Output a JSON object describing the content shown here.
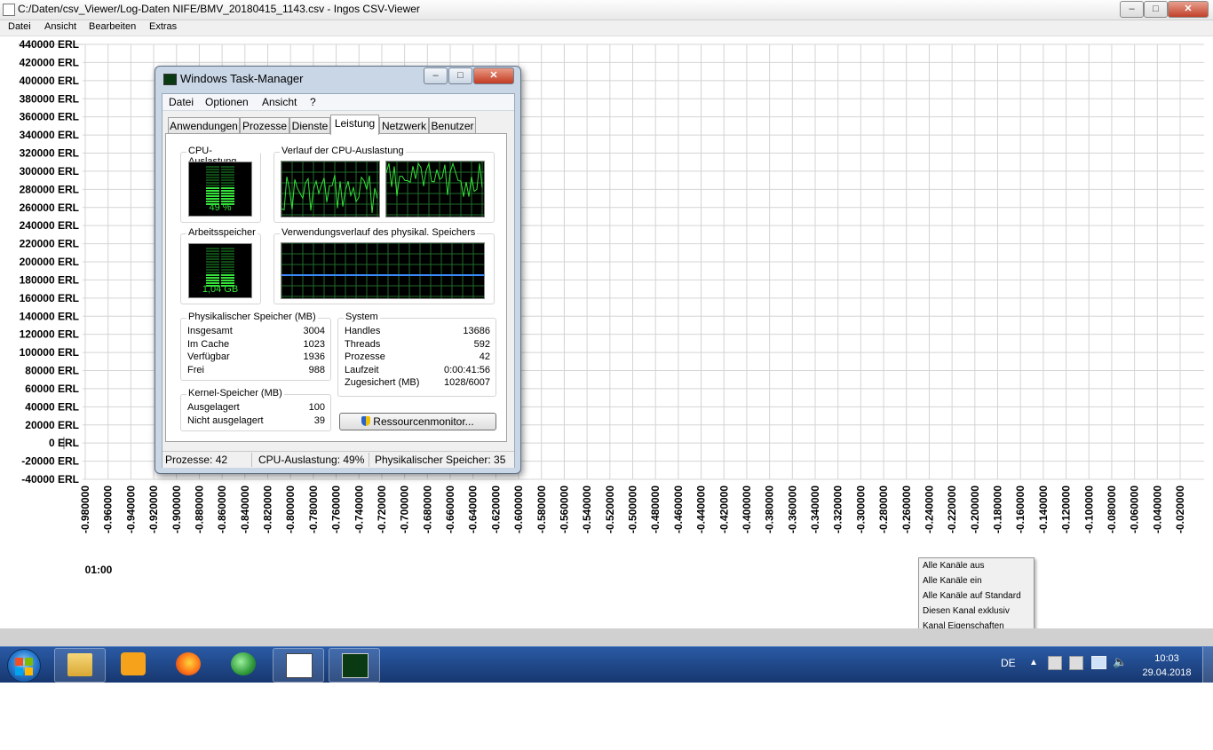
{
  "window": {
    "title": "C:/Daten/csv_Viewer/Log-Daten NIFE/BMV_20180415_1143.csv - Ingos CSV-Viewer",
    "menu": [
      "Datei",
      "Ansicht",
      "Bearbeiten",
      "Extras"
    ]
  },
  "chart": {
    "y_ticks": [
      "440000 ERL",
      "420000 ERL",
      "400000 ERL",
      "380000 ERL",
      "360000 ERL",
      "340000 ERL",
      "320000 ERL",
      "300000 ERL",
      "280000 ERL",
      "260000 ERL",
      "240000 ERL",
      "220000 ERL",
      "200000 ERL",
      "180000 ERL",
      "160000 ERL",
      "140000 ERL",
      "120000 ERL",
      "100000 ERL",
      "80000 ERL",
      "60000 ERL",
      "40000 ERL",
      "20000 ERL",
      "0 ERL",
      "-20000 ERL",
      "-40000 ERL"
    ],
    "x_ticks": [
      "-0.980000",
      "-0.960000",
      "-0.940000",
      "-0.920000",
      "-0.900000",
      "-0.880000",
      "-0.860000",
      "-0.840000",
      "-0.820000",
      "-0.800000",
      "-0.780000",
      "-0.760000",
      "-0.740000",
      "-0.720000",
      "-0.700000",
      "-0.680000",
      "-0.660000",
      "-0.640000",
      "-0.620000",
      "-0.600000",
      "-0.580000",
      "-0.560000",
      "-0.540000",
      "-0.520000",
      "-0.500000",
      "-0.480000",
      "-0.460000",
      "-0.440000",
      "-0.420000",
      "-0.400000",
      "-0.380000",
      "-0.360000",
      "-0.340000",
      "-0.320000",
      "-0.300000",
      "-0.280000",
      "-0.260000",
      "-0.240000",
      "-0.220000",
      "-0.200000",
      "-0.180000",
      "-0.160000",
      "-0.140000",
      "-0.120000",
      "-0.100000",
      "-0.080000",
      "-0.060000",
      "-0.040000",
      "-0.020000"
    ],
    "time_label": "01:00"
  },
  "chart_data": {
    "type": "line",
    "ylim": [
      -40000,
      440000
    ],
    "xlim": [
      -0.98,
      -0.02
    ],
    "grid": true,
    "series": []
  },
  "taskmanager": {
    "title": "Windows Task-Manager",
    "menu": [
      "Datei",
      "Optionen",
      "Ansicht",
      "?"
    ],
    "tabs": [
      "Anwendungen",
      "Prozesse",
      "Dienste",
      "Leistung",
      "Netzwerk",
      "Benutzer"
    ],
    "active_tab": "Leistung",
    "cpu_label": "CPU-Auslastung",
    "cpu_value": "49 %",
    "cpu_level": 0.49,
    "cpu_history_label": "Verlauf der CPU-Auslastung",
    "mem_label": "Arbeitsspeicher",
    "mem_value": "1,04 GB",
    "mem_level": 0.35,
    "mem_history_label": "Verwendungsverlauf des physikal. Speichers",
    "phys": {
      "title": "Physikalischer Speicher (MB)",
      "rows": [
        {
          "label": "Insgesamt",
          "value": "3004"
        },
        {
          "label": "Im Cache",
          "value": "1023"
        },
        {
          "label": "Verfügbar",
          "value": "1936"
        },
        {
          "label": "Frei",
          "value": "988"
        }
      ]
    },
    "kernel": {
      "title": "Kernel-Speicher (MB)",
      "rows": [
        {
          "label": "Ausgelagert",
          "value": "100"
        },
        {
          "label": "Nicht ausgelagert",
          "value": "39"
        }
      ]
    },
    "system": {
      "title": "System",
      "rows": [
        {
          "label": "Handles",
          "value": "13686"
        },
        {
          "label": "Threads",
          "value": "592"
        },
        {
          "label": "Prozesse",
          "value": "42"
        },
        {
          "label": "Laufzeit",
          "value": "0:00:41:56"
        },
        {
          "label": "Zugesichert (MB)",
          "value": "1028/6007"
        }
      ]
    },
    "resource_button": "Ressourcenmonitor...",
    "status": {
      "processes": "Prozesse: 42",
      "cpu": "CPU-Auslastung: 49%",
      "mem": "Physikalischer Speicher: 35"
    }
  },
  "context_menu": [
    "Alle Kanäle aus",
    "Alle Kanäle ein",
    "Alle Kanäle auf Standard",
    "Diesen Kanal exklusiv",
    "Kanal Eigenschaften"
  ],
  "taskbar": {
    "language": "DE",
    "time": "10:03",
    "date": "29.04.2018",
    "apps": [
      "explorer-icon",
      "outlook-icon",
      "firefox-icon",
      "network-globe-icon",
      "csv-viewer-icon",
      "taskmanager-icon"
    ]
  },
  "colors": {
    "graph_green": "#35e33a",
    "graph_grid": "#1f6b2a",
    "taskbar": "#1f4a8c",
    "close_red": "#c23b23"
  }
}
